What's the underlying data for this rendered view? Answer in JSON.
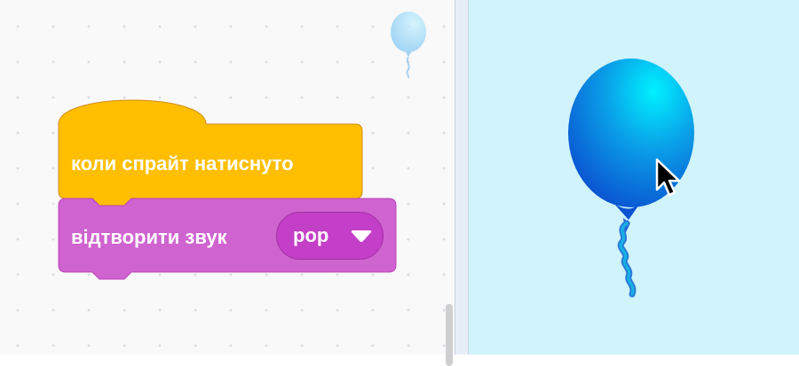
{
  "workspace": {
    "hat_block": {
      "label": "коли спрайт натиснуто",
      "color": "#ffbf00"
    },
    "sound_block": {
      "label": "відтворити звук",
      "color": "#cf63cf",
      "sound_dropdown": {
        "value": "pop",
        "icon": "caret-down-icon"
      }
    }
  },
  "stage": {
    "background_color": "#d0f3fc",
    "sprite": "balloon"
  }
}
